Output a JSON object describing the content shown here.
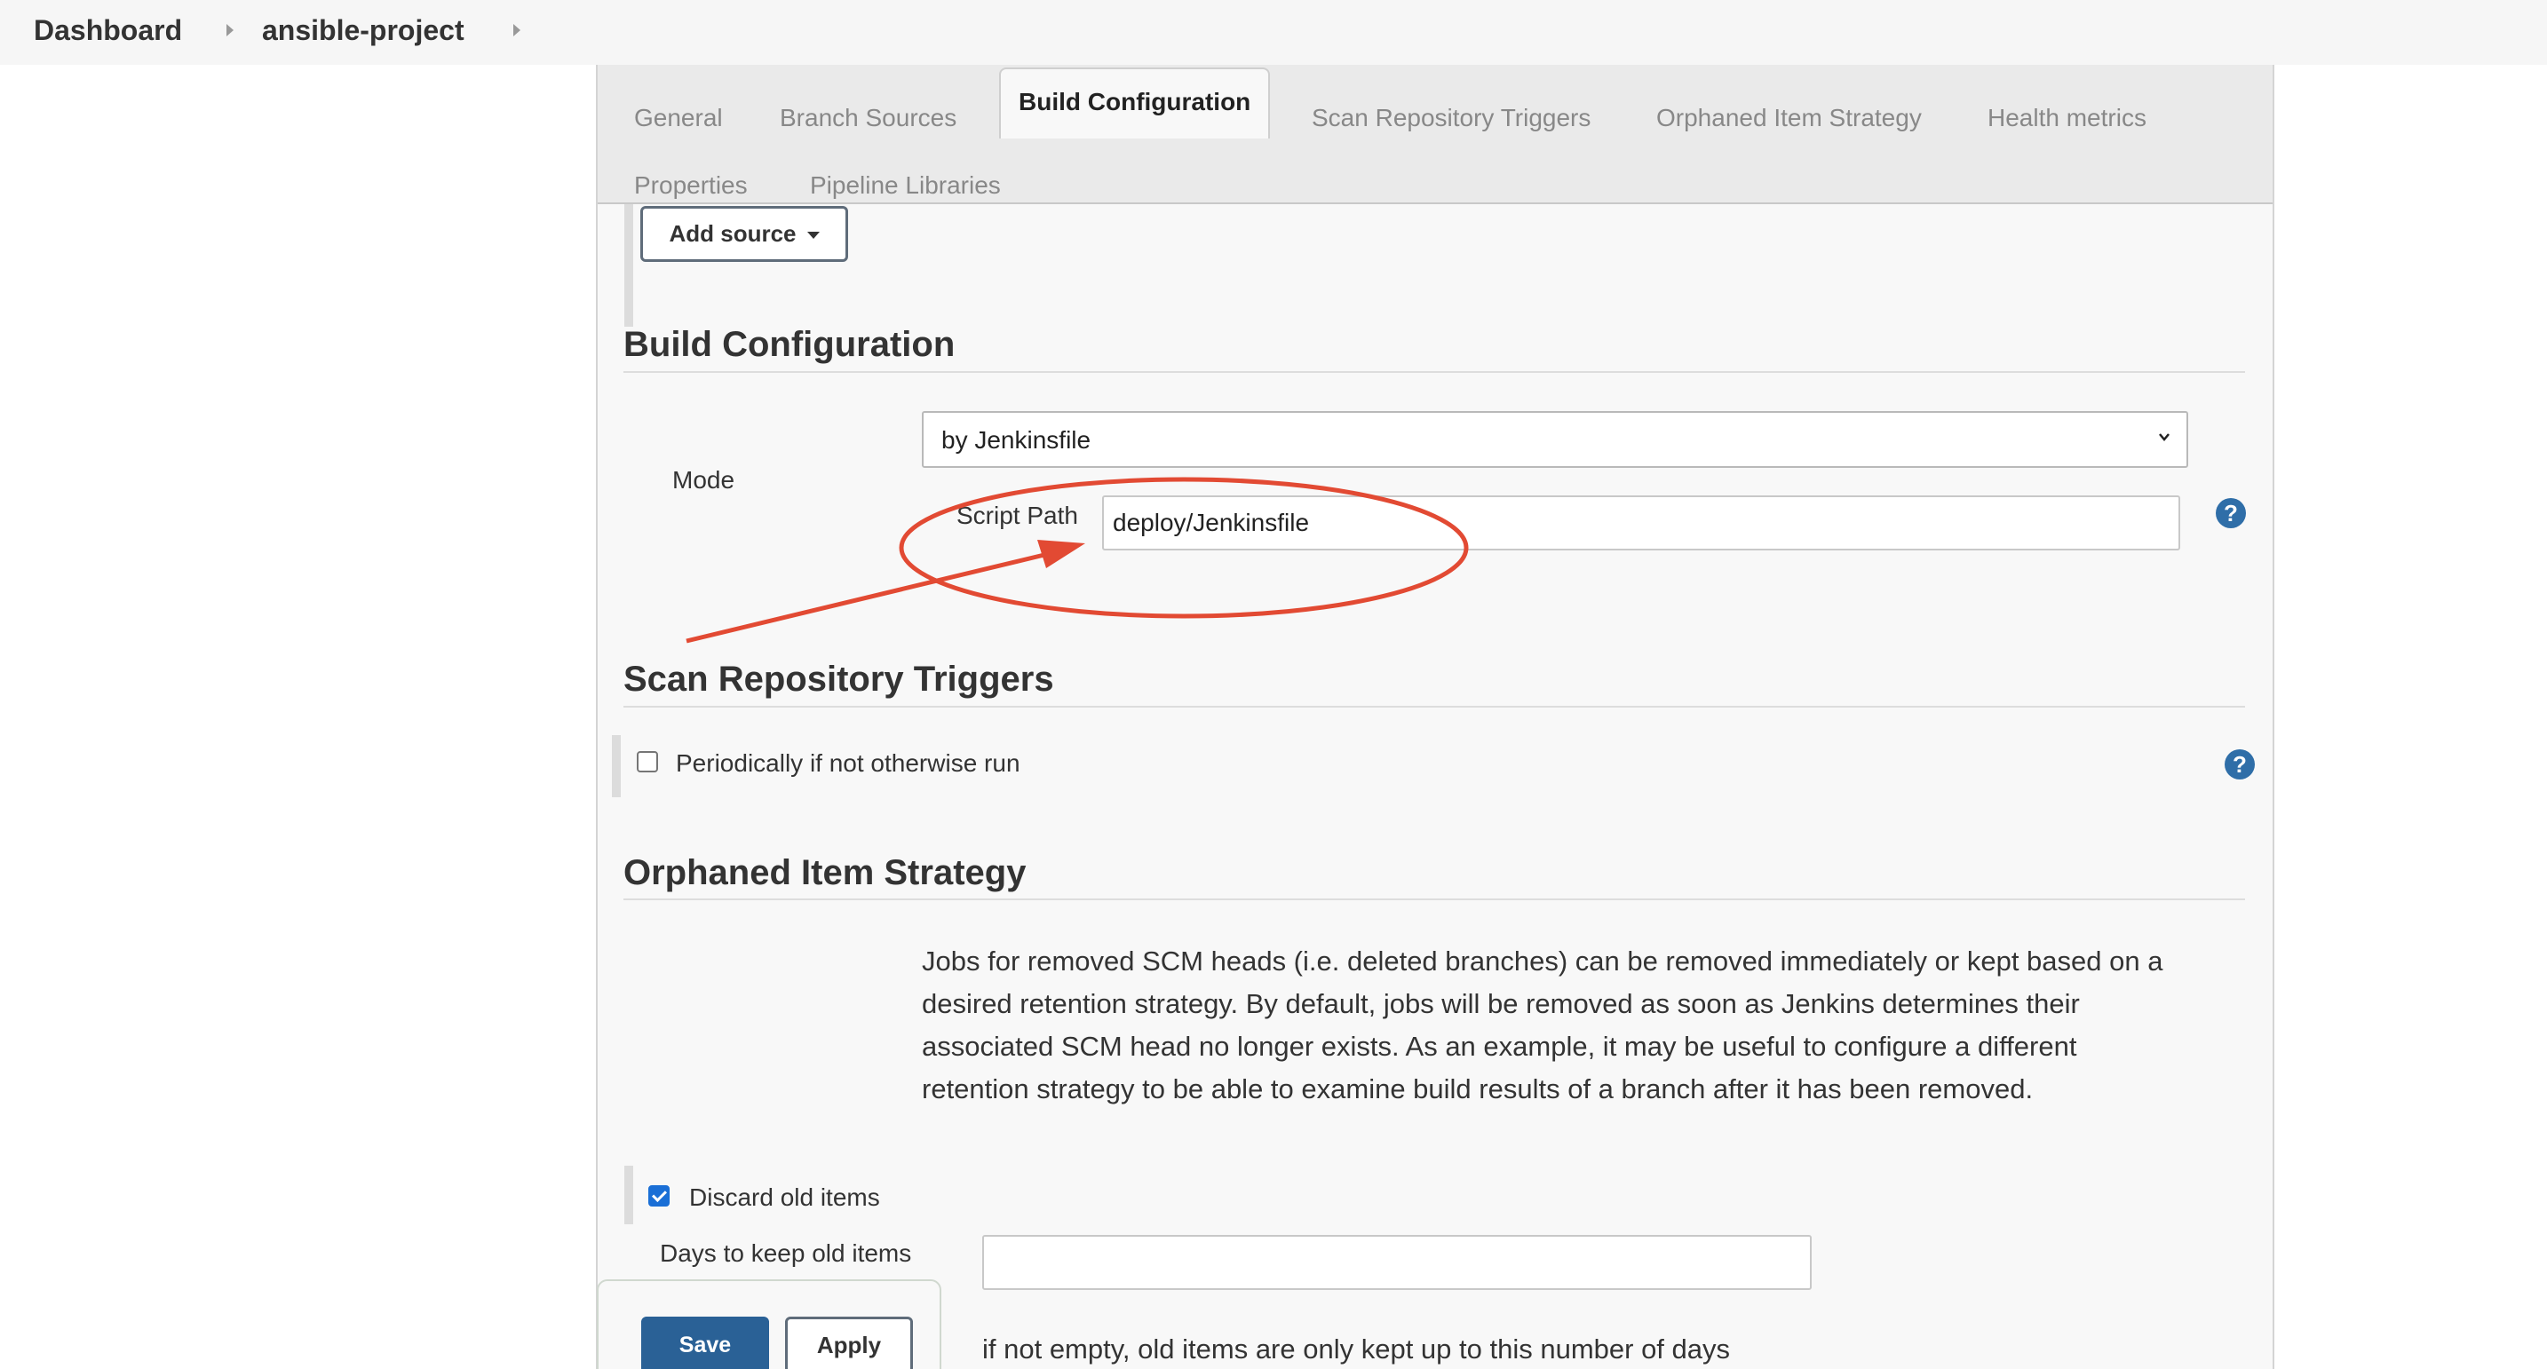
{
  "breadcrumbs": {
    "dashboard": "Dashboard",
    "project": "ansible-project"
  },
  "tabs": [
    {
      "label": "General",
      "active": false
    },
    {
      "label": "Branch Sources",
      "active": false
    },
    {
      "label": "Build Configuration",
      "active": true
    },
    {
      "label": "Scan Repository Triggers",
      "active": false
    },
    {
      "label": "Orphaned Item Strategy",
      "active": false
    },
    {
      "label": "Health metrics",
      "active": false
    },
    {
      "label": "Properties",
      "active": false
    },
    {
      "label": "Pipeline Libraries",
      "active": false
    }
  ],
  "sources": {
    "add_source_label": "Add source"
  },
  "build_config": {
    "title": "Build Configuration",
    "mode_label": "Mode",
    "mode_value": "by Jenkinsfile",
    "script_path_label": "Script Path",
    "script_path_value": "deploy/Jenkinsfile",
    "help_glyph": "?"
  },
  "scan_triggers": {
    "title": "Scan Repository Triggers",
    "periodically_label": "Periodically if not otherwise run",
    "periodically_checked": false,
    "help_glyph": "?"
  },
  "orphaned": {
    "title": "Orphaned Item Strategy",
    "description": "Jobs for removed SCM heads (i.e. deleted branches) can be removed immediately or kept based on a desired retention strategy. By default, jobs will be removed as soon as Jenkins determines their associated SCM head no longer exists. As an example, it may be useful to configure a different retention strategy to be able to examine build results of a branch after it has been removed.",
    "discard_label": "Discard old items",
    "discard_checked": true,
    "days_label": "Days to keep old items",
    "days_value": "",
    "days_hint": "if not empty, old items are only kept up to this number of days"
  },
  "actions": {
    "save_label": "Save",
    "apply_label": "Apply"
  },
  "colors": {
    "annotation": "#e24a33",
    "primary": "#2a6196",
    "help": "#2f6ea8"
  }
}
